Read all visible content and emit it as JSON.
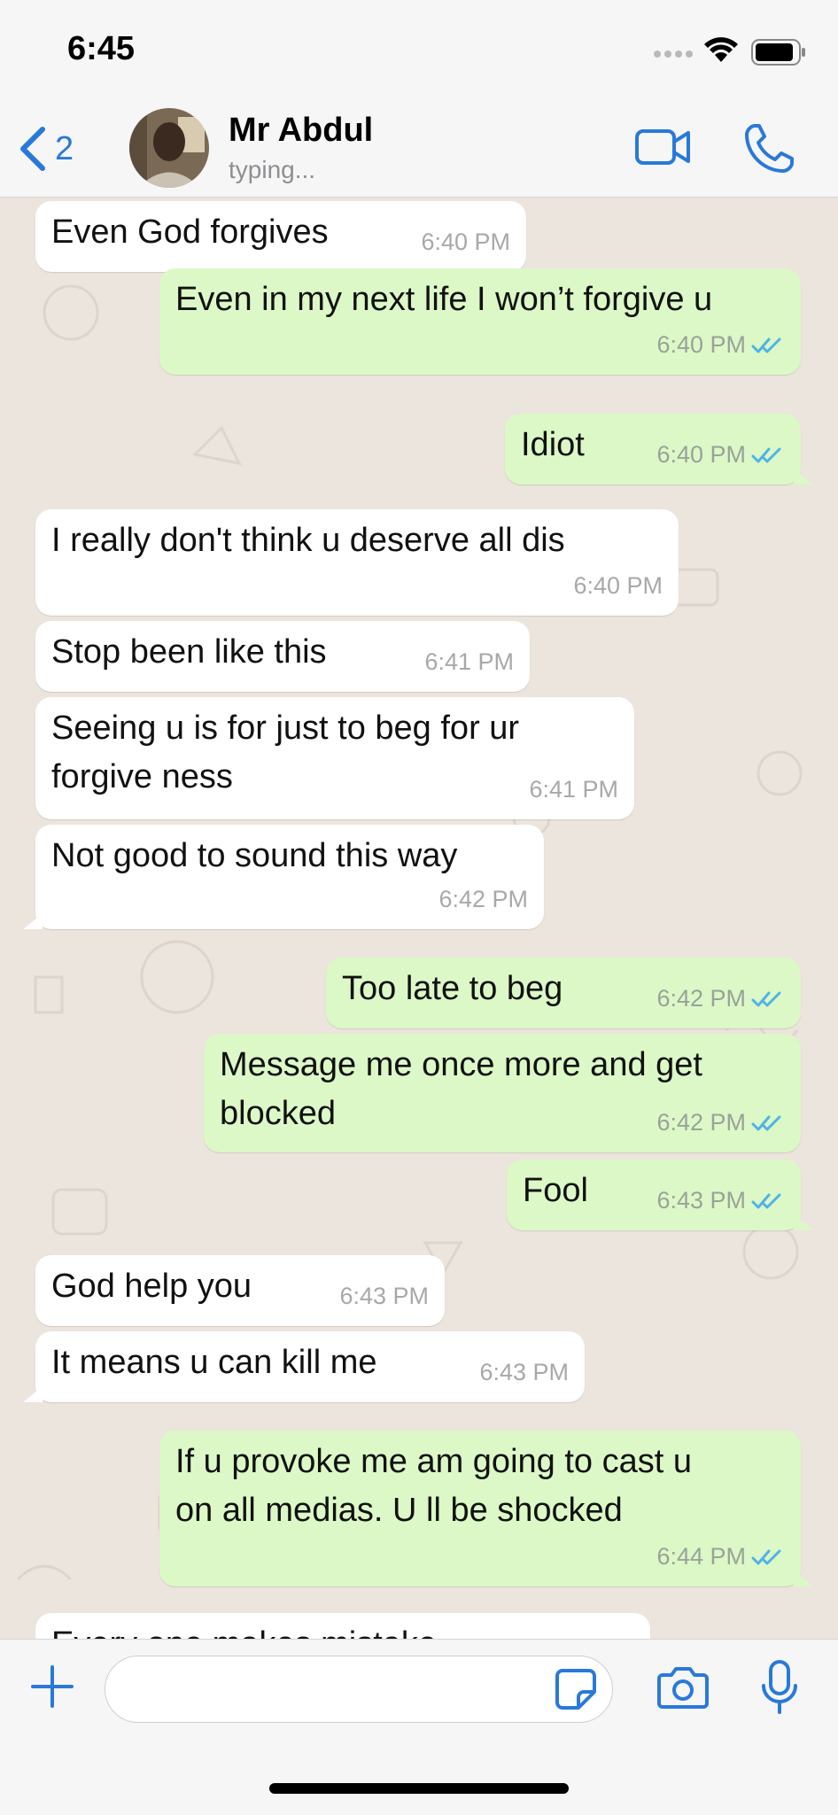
{
  "status_bar": {
    "time": "6:45"
  },
  "header": {
    "back_count": "2",
    "contact_name": "Mr Abdul",
    "subtitle": "typing..."
  },
  "colors": {
    "accent": "#2979d9",
    "incoming_bubble": "#ffffff",
    "outgoing_bubble": "#dcf8c6",
    "chat_background": "#ece5dd",
    "read_ticks": "#4fb3e8"
  },
  "messages": [
    {
      "direction": "in",
      "text": "Even God forgives",
      "time": "6:40 PM"
    },
    {
      "direction": "out",
      "text": "Even in my next life I won’t forgive u",
      "time": "6:40 PM",
      "read": true
    },
    {
      "direction": "out",
      "text": "Idiot",
      "time": "6:40 PM",
      "read": true
    },
    {
      "direction": "in",
      "text": "I really don't think u deserve all dis",
      "time": "6:40 PM"
    },
    {
      "direction": "in",
      "text": "Stop been like this",
      "time": "6:41 PM"
    },
    {
      "direction": "in",
      "text_line1": "Seeing u is for just to beg for ur",
      "text_line2": "forgive ness",
      "time": "6:41 PM"
    },
    {
      "direction": "in",
      "text": "Not good to sound this way",
      "time": "6:42 PM"
    },
    {
      "direction": "out",
      "text": "Too late to beg",
      "time": "6:42 PM",
      "read": true
    },
    {
      "direction": "out",
      "text_line1": "Message me once more and get",
      "text_line2": "blocked",
      "time": "6:42 PM",
      "read": true
    },
    {
      "direction": "out",
      "text": "Fool",
      "time": "6:43 PM",
      "read": true
    },
    {
      "direction": "in",
      "text": "God help you",
      "time": "6:43 PM"
    },
    {
      "direction": "in",
      "text": "It means u can kill me",
      "time": "6:43 PM"
    },
    {
      "direction": "out",
      "text_line1": "If u provoke me am going to cast u",
      "text_line2": "on all medias. U ll be shocked",
      "time": "6:44 PM",
      "read": true
    },
    {
      "direction": "in",
      "text": "Every one makes mistake",
      "partial": true
    }
  ],
  "icons": {
    "back": "chevron-left-icon",
    "video": "video-camera-icon",
    "call": "phone-icon",
    "attach": "plus-icon",
    "sticker": "sticker-icon",
    "camera": "camera-icon",
    "mic": "microphone-icon"
  }
}
